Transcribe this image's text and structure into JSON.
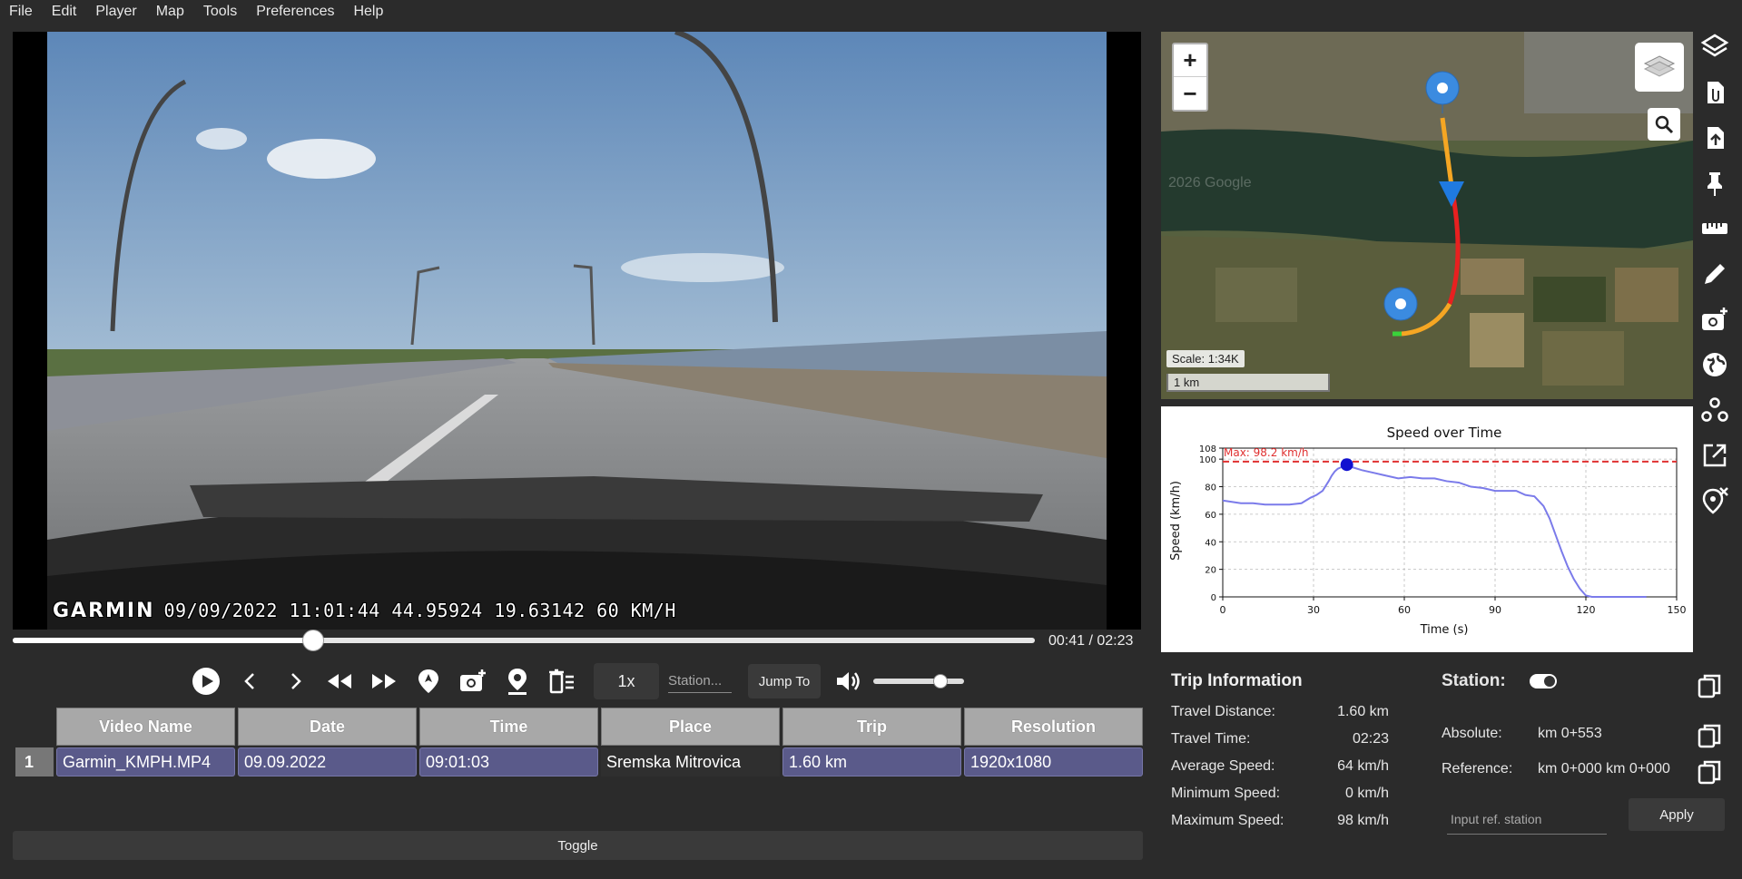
{
  "menu": [
    "File",
    "Edit",
    "Player",
    "Map",
    "Tools",
    "Preferences",
    "Help"
  ],
  "video": {
    "osd_brand": "GARMIN",
    "osd_text": "09/09/2022 11:01:44  44.95924 19.63142  60 KM/H",
    "progress_fraction": 0.294
  },
  "player": {
    "timecode": "00:41 / 02:23",
    "speed": "1x",
    "station_placeholder": "Station...",
    "jump_label": "Jump To",
    "volume_fraction": 0.74,
    "icons": [
      "play-icon",
      "previous-frame-icon",
      "next-frame-icon",
      "rewind-icon",
      "fast-forward-icon",
      "map-marker-icon",
      "add-photo-icon",
      "location-pin-icon",
      "delete-list-icon",
      "volume-icon"
    ]
  },
  "table": {
    "headers": [
      "Video Name",
      "Date",
      "Time",
      "Place",
      "Trip",
      "Resolution"
    ],
    "rows": [
      {
        "index": "1",
        "cells": [
          "Garmin_KMPH.MP4",
          "09.09.2022",
          "09:01:03",
          "Sremska Mitrovica",
          "1.60 km",
          "1920x1080"
        ]
      }
    ]
  },
  "toggle_label": "Toggle",
  "map": {
    "zoom_in": "+",
    "zoom_out": "−",
    "scale_label": "Scale: 1:34K",
    "scale_bar": "1 km",
    "watermark": "2026 Google"
  },
  "chart_data": {
    "type": "line",
    "title": "Speed over Time",
    "xlabel": "Time (s)",
    "ylabel": "Speed (km/h)",
    "xlim": [
      0,
      150
    ],
    "ylim": [
      0,
      108
    ],
    "xticks": [
      0,
      30,
      60,
      90,
      120,
      150
    ],
    "yticks": [
      0,
      20,
      40,
      60,
      80,
      100,
      108
    ],
    "grid": true,
    "max_line": {
      "value": 98.2,
      "label": "Max: 98.2 km/h",
      "color": "#e03030"
    },
    "current_point": {
      "x": 41,
      "y": 96
    },
    "series": [
      {
        "color": "#7b7bea",
        "x": [
          0,
          3,
          6,
          10,
          14,
          18,
          22,
          26,
          29,
          31,
          33,
          35,
          36,
          37,
          38,
          39,
          40,
          41,
          43,
          46,
          50,
          54,
          58,
          62,
          66,
          70,
          74,
          78,
          82,
          86,
          90,
          94,
          97,
          100,
          103,
          106,
          108,
          110,
          112,
          114,
          116,
          118,
          120,
          122,
          126,
          130,
          134,
          138,
          140
        ],
        "y": [
          70,
          69,
          68,
          68,
          67,
          67,
          67,
          68,
          72,
          74,
          77,
          84,
          88,
          91,
          93,
          94,
          95,
          96,
          94,
          92,
          90,
          88,
          86,
          87,
          86,
          86,
          84,
          83,
          80,
          79,
          77,
          77,
          77,
          74,
          73,
          66,
          57,
          45,
          33,
          22,
          13,
          6,
          1,
          0,
          0,
          0,
          0,
          0,
          0
        ]
      }
    ]
  },
  "trip": {
    "title": "Trip Information",
    "rows": [
      {
        "label": "Travel Distance:",
        "value": "1.60 km"
      },
      {
        "label": "Travel Time:",
        "value": "02:23"
      },
      {
        "label": "Average Speed:",
        "value": "64 km/h"
      },
      {
        "label": "Minimum Speed:",
        "value": "0 km/h"
      },
      {
        "label": "Maximum Speed:",
        "value": "98 km/h"
      }
    ]
  },
  "station": {
    "title": "Station:",
    "absolute_label": "Absolute:",
    "absolute_value": "km 0+553",
    "reference_label": "Reference:",
    "reference_value": "km 0+000  km 0+000",
    "ref_placeholder": "Input ref. station",
    "apply_label": "Apply"
  },
  "sidebar": [
    "layers-icon",
    "attach-file-icon",
    "upload-file-icon",
    "pin-icon",
    "ruler-icon",
    "edit-icon",
    "add-photo-icon",
    "globe-icon",
    "group-icon",
    "open-external-icon",
    "remove-location-icon"
  ],
  "colors": {
    "accent": "#5a5a8a",
    "background": "#2b2b2b",
    "chart_line": "#7b7bea",
    "max_line": "#e03030"
  }
}
